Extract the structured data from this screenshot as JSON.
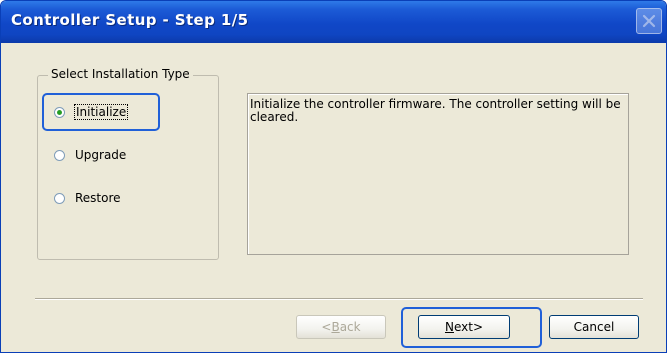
{
  "window": {
    "title": "Controller Setup - Step 1/5"
  },
  "installation_type": {
    "legend": "Select Installation Type",
    "options": [
      {
        "label": "Initialize",
        "selected": true
      },
      {
        "label": "Upgrade",
        "selected": false
      },
      {
        "label": "Restore",
        "selected": false
      }
    ]
  },
  "description": {
    "text": "Initialize the controller firmware. The controller setting will be cleared."
  },
  "buttons": {
    "back_arrow": "< ",
    "back_mnemonic": "B",
    "back_rest": "ack",
    "next_mnemonic": "N",
    "next_rest": "ext",
    "next_arrow": " >",
    "cancel": "Cancel"
  },
  "colors": {
    "titlebar": "#0f45c2",
    "dialog_bg": "#ece9d8",
    "highlight": "#2060d8"
  }
}
